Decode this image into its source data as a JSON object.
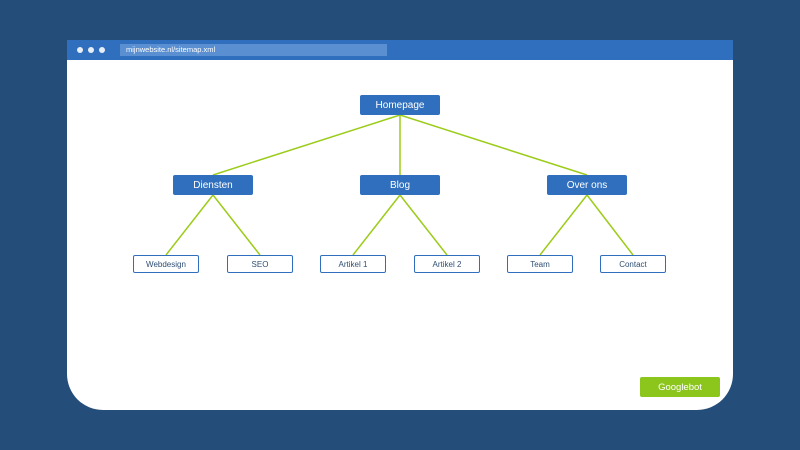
{
  "browser": {
    "url": "mijnwebsite.nl/sitemap.xml"
  },
  "sitemap": {
    "root": "Homepage",
    "sections": [
      {
        "label": "Diensten",
        "children": [
          "Webdesign",
          "SEO"
        ]
      },
      {
        "label": "Blog",
        "children": [
          "Artikel 1",
          "Artikel 2"
        ]
      },
      {
        "label": "Over ons",
        "children": [
          "Team",
          "Contact"
        ]
      }
    ]
  },
  "crawler": {
    "label": "Googlebot"
  },
  "colors": {
    "background": "#254d7a",
    "node": "#2f6fbd",
    "connector": "#9ccc1a",
    "crawler": "#8cc61c"
  }
}
